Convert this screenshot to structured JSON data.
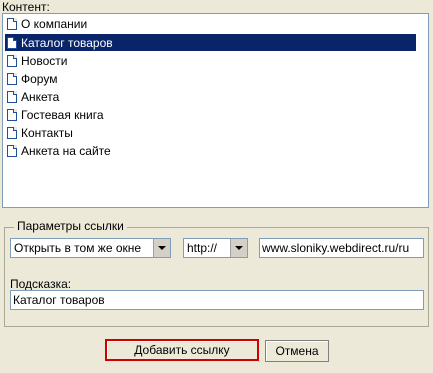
{
  "content_label": "Контент:",
  "list": {
    "items": [
      {
        "label": "О компании",
        "selected": false
      },
      {
        "label": "Каталог товаров",
        "selected": true
      },
      {
        "label": "Новости",
        "selected": false
      },
      {
        "label": "Форум",
        "selected": false
      },
      {
        "label": "Анкета",
        "selected": false
      },
      {
        "label": "Гостевая книга",
        "selected": false
      },
      {
        "label": "Контакты",
        "selected": false
      },
      {
        "label": "Анкета на сайте",
        "selected": false
      }
    ]
  },
  "link_params": {
    "title": "Параметры ссылки",
    "target_value": "Открыть в том же окне",
    "protocol_value": "http://",
    "url_value": "www.sloniky.webdirect.ru/ru",
    "hint_label": "Подсказка:",
    "hint_value": "Каталог товаров"
  },
  "buttons": {
    "add_link": "Добавить ссылку",
    "cancel": "Отмена"
  },
  "colors": {
    "selection": "#0a246a",
    "default_button_border": "#d00000",
    "background": "#ece9d8"
  }
}
